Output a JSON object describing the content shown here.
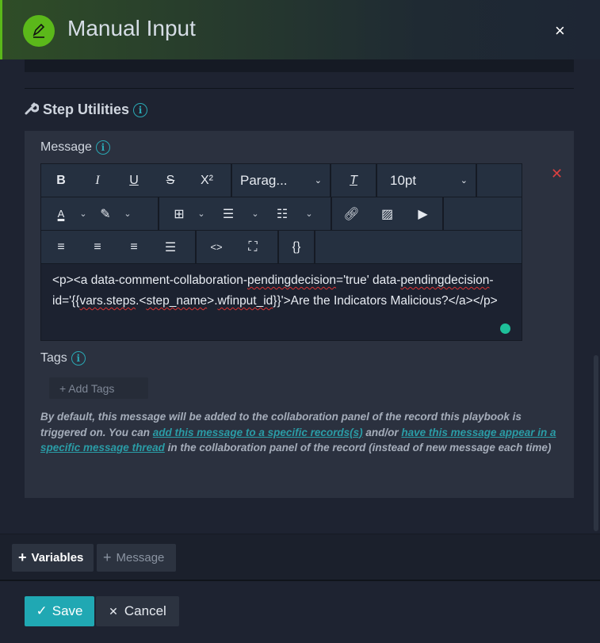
{
  "header": {
    "title": "Manual Input",
    "close": "×"
  },
  "section": {
    "title": "Step Utilities",
    "info": "i"
  },
  "message": {
    "label": "Message",
    "info": "i"
  },
  "toolbar": {
    "bold": "B",
    "italic": "I",
    "underline": "U",
    "strike": "S",
    "superscript": "X²",
    "block_format": "Parag...",
    "clear_format": "T",
    "font_size": "10pt",
    "code": "<>",
    "source": "{}"
  },
  "content": {
    "part1": "<p><a data-comment-collaboration-",
    "w1": "pendingdecision",
    "part2": "='true' data-",
    "w2": "pendingdecision",
    "part3": "-id='{{",
    "w3": "vars.steps",
    "part4": ".<",
    "w4": "step_name",
    "part5": ">.",
    "w5": "wfinput_id",
    "part6": "}}'>Are the Indicators Malicious?</a></p>"
  },
  "remove": "✕",
  "tags": {
    "label": "Tags",
    "info": "i",
    "add": "+ Add Tags"
  },
  "note": {
    "t1": "By default, this message will be added to the collaboration panel of the record this playbook is triggered on. You can ",
    "link1": "add this message to a specific records(s)",
    "t2": " and/or ",
    "link2": "have this message appear in a specific message thread",
    "t3": " in the collaboration panel of the record (instead of new message each time)"
  },
  "bottom": {
    "variables": "Variables",
    "message": "Message",
    "plus": "+"
  },
  "footer": {
    "save": "Save",
    "cancel": "Cancel",
    "check": "✓",
    "x": "✕"
  }
}
